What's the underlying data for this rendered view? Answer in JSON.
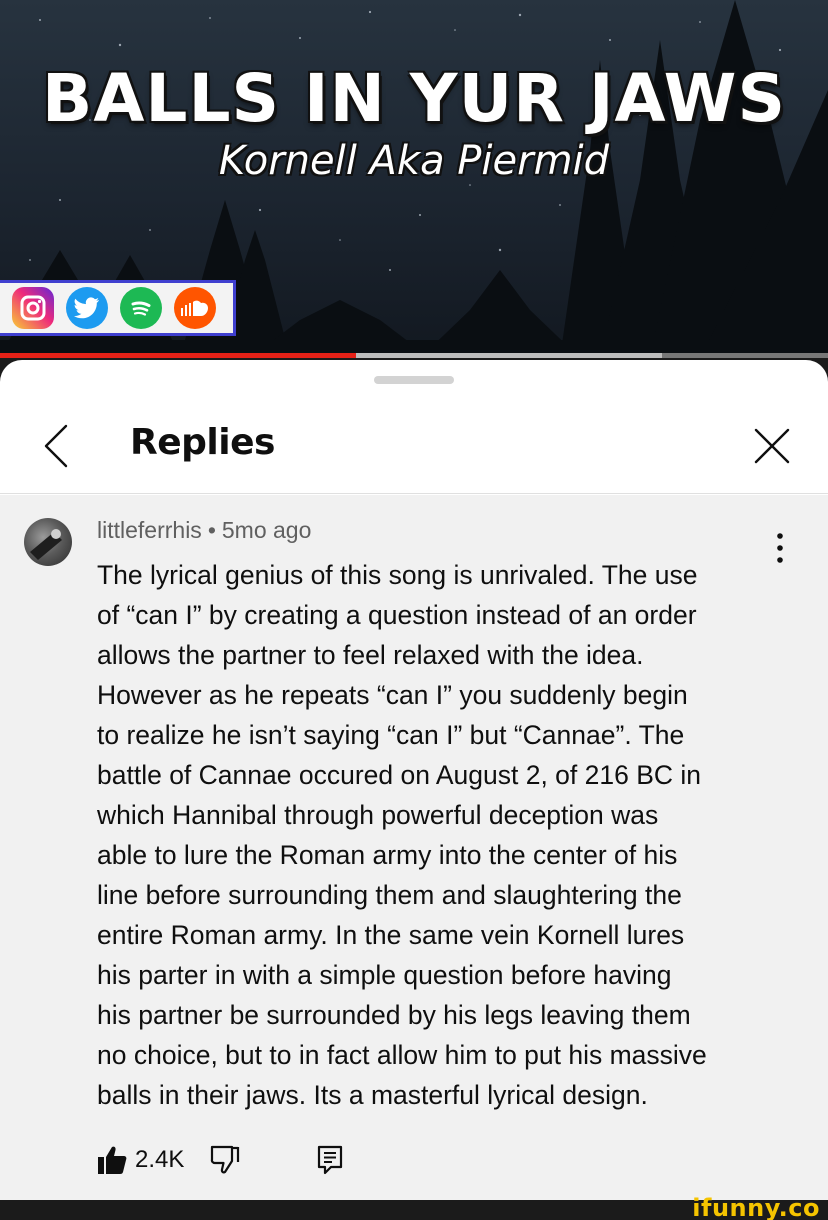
{
  "video": {
    "title": "BALLS IN YUR JAWS",
    "subtitle": "Kornell Aka Piermid",
    "social_icons": [
      "instagram-icon",
      "twitter-icon",
      "spotify-icon",
      "soundcloud-icon"
    ],
    "progress": {
      "played_fraction": 0.43,
      "buffered_fraction": 0.8
    },
    "colors": {
      "progress_played": "#e62117",
      "social_bar_border": "#3f3fcf"
    }
  },
  "sheet": {
    "title": "Replies",
    "back_icon": "chevron-left-icon",
    "close_icon": "close-icon"
  },
  "comment": {
    "author": "littleferrhis",
    "separator": "•",
    "time": "5mo ago",
    "text": "The lyrical genius of this song is unrivaled. The use\nof “can I” by creating a question instead of an order\nallows the partner to feel relaxed with the idea.\nHowever as he repeats “can I” you suddenly begin\nto realize he isn’t saying “can I” but “Cannae”. The\nbattle of Cannae occured on August 2, of 216 BC in\nwhich Hannibal through powerful deception was\nable to lure the Roman army into the center of his\nline before surrounding them and slaughtering the\nentire Roman army. In the same vein Kornell lures\nhis parter in with a simple question before having\nhis partner be surrounded by his legs leaving them\nno choice, but to in fact allow him to put his massive\nballs in their jaws. Its a masterful lyrical design.",
    "like_count": "2.4K",
    "icons": [
      "thumbs-up-icon",
      "thumbs-down-icon",
      "reply-icon",
      "more-vertical-icon"
    ]
  },
  "watermark": "ifunny.co"
}
